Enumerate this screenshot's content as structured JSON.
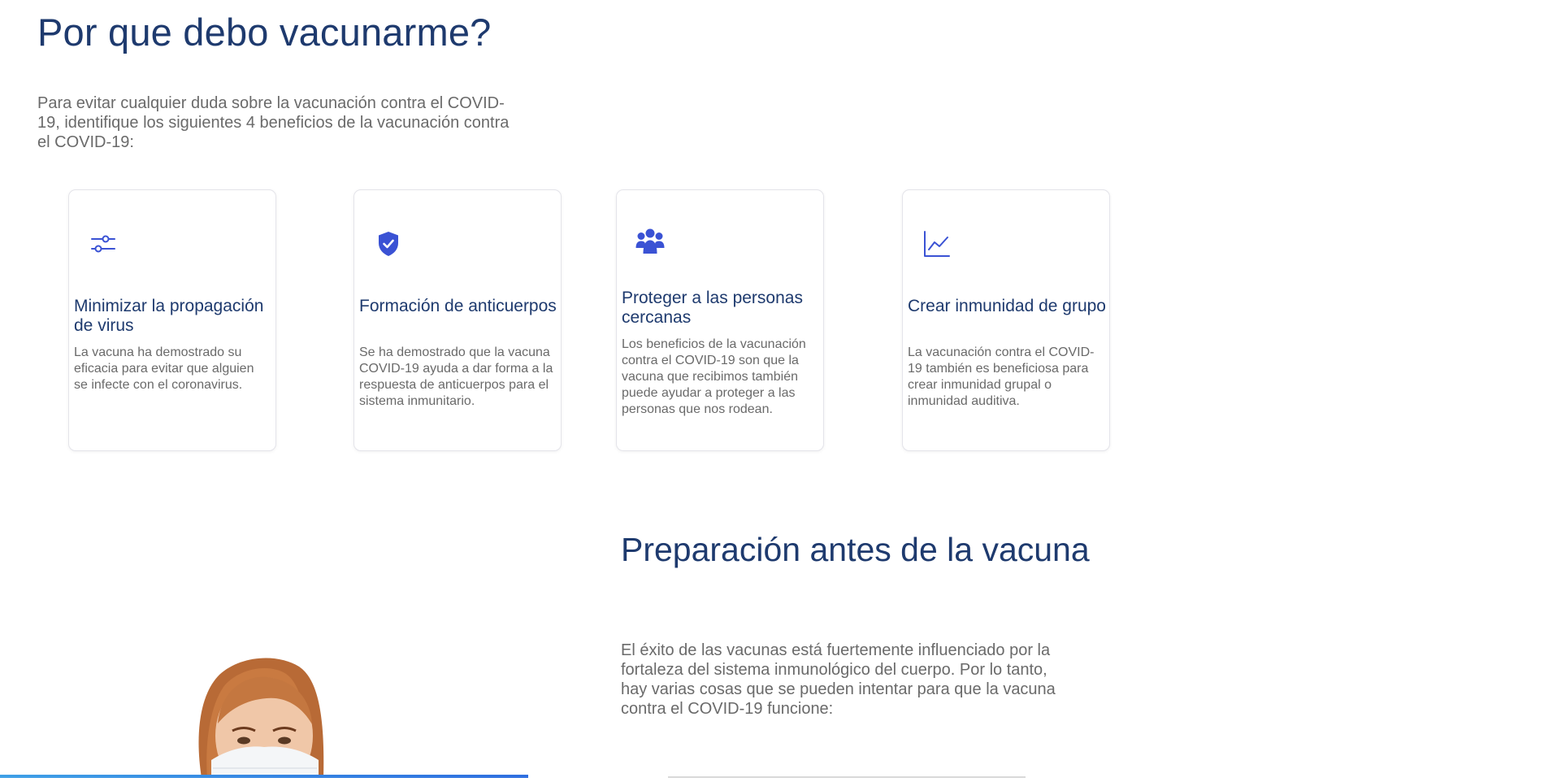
{
  "section1": {
    "title": "Por que debo vacunarme?",
    "intro": "Para evitar cualquier duda sobre la vacunación contra el COVID-19, identifique los siguientes 4 beneficios de la vacunación contra el COVID-19:"
  },
  "cards": [
    {
      "icon": "sliders-icon",
      "title": "Minimizar la propagación de virus",
      "text": "La vacuna ha demostrado su eficacia para evitar que alguien se infecte con el coronavirus."
    },
    {
      "icon": "shield-check-icon",
      "title": "Formación de anticuerpos",
      "text": "Se ha demostrado que la vacuna COVID-19 ayuda a dar forma a la respuesta de anticuerpos para el sistema inmunitario."
    },
    {
      "icon": "people-group-icon",
      "title": "Proteger a las personas cercanas",
      "text": "Los beneficios de la vacunación contra el COVID-19 son que la vacuna que recibimos también puede ayudar a proteger a las personas que nos rodean."
    },
    {
      "icon": "line-chart-icon",
      "title": "Crear inmunidad de grupo",
      "text": "La vacunación contra el COVID-19 también es beneficiosa para crear inmunidad grupal o inmunidad auditiva."
    }
  ],
  "section2": {
    "title": "Preparación antes de la vacuna",
    "text": "El éxito de las vacunas está fuertemente influenciado por la fortaleza del sistema inmunológico del cuerpo. Por lo tanto, hay varias cosas que se pueden intentar para que la vacuna contra el COVID-19 funcione:"
  },
  "colors": {
    "heading": "#1e3a6e",
    "body_text": "#6a6a6a",
    "icon_accent": "#3a52d4",
    "bar_accent": "#2f6fe0"
  }
}
